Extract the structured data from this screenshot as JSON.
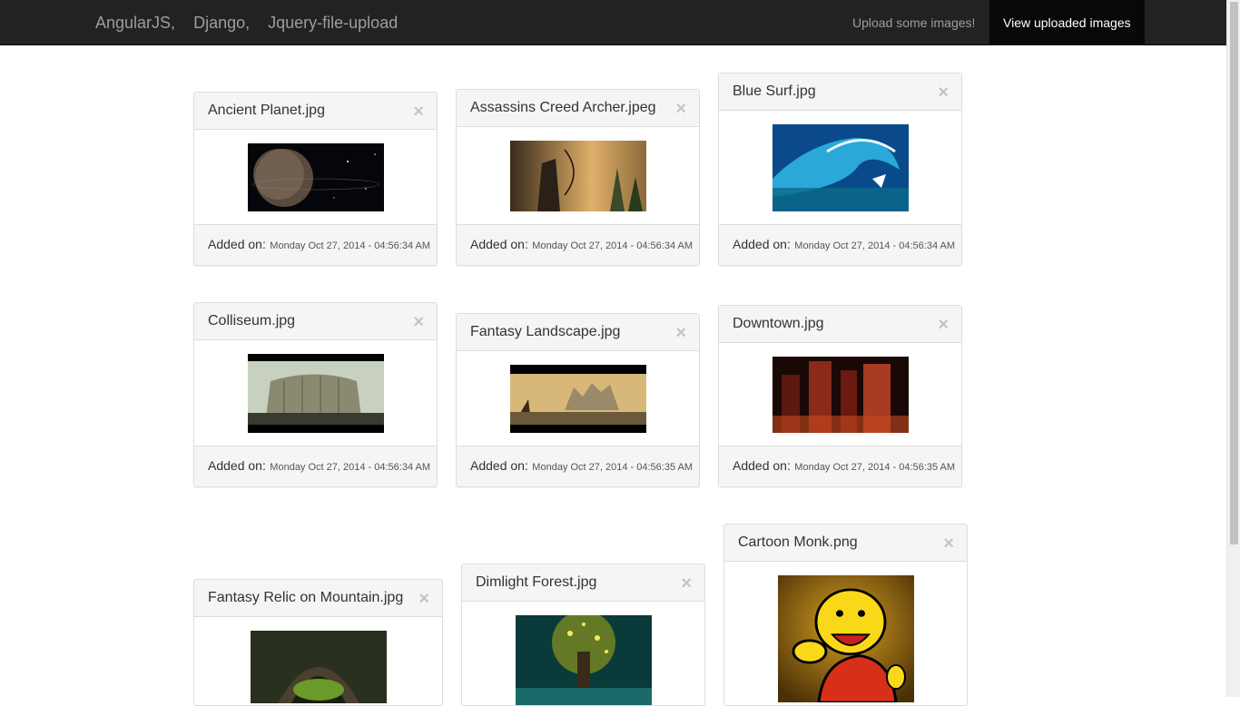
{
  "navbar": {
    "brand": [
      "AngularJS,",
      "Django,",
      "Jquery-file-upload"
    ],
    "links": [
      {
        "label": "Upload some images!",
        "active": false
      },
      {
        "label": "View uploaded images",
        "active": true
      }
    ]
  },
  "images": [
    {
      "name": "Ancient Planet.jpg",
      "added_label": "Added on:",
      "date": "Monday Oct 27, 2014 - 04:56:34 AM",
      "close": "×"
    },
    {
      "name": "Assassins Creed Archer.jpeg",
      "added_label": "Added on:",
      "date": "Monday Oct 27, 2014 - 04:56:34 AM",
      "close": "×"
    },
    {
      "name": "Blue Surf.jpg",
      "added_label": "Added on:",
      "date": "Monday Oct 27, 2014 - 04:56:34 AM",
      "close": "×"
    },
    {
      "name": "Colliseum.jpg",
      "added_label": "Added on:",
      "date": "Monday Oct 27, 2014 - 04:56:34 AM",
      "close": "×"
    },
    {
      "name": "Fantasy Landscape.jpg",
      "added_label": "Added on:",
      "date": "Monday Oct 27, 2014 - 04:56:35 AM",
      "close": "×"
    },
    {
      "name": "Downtown.jpg",
      "added_label": "Added on:",
      "date": "Monday Oct 27, 2014 - 04:56:35 AM",
      "close": "×"
    },
    {
      "name": "Fantasy Relic on Mountain.jpg",
      "close": "×"
    },
    {
      "name": "Dimlight Forest.jpg",
      "close": "×"
    },
    {
      "name": "Cartoon Monk.png",
      "close": "×"
    }
  ]
}
